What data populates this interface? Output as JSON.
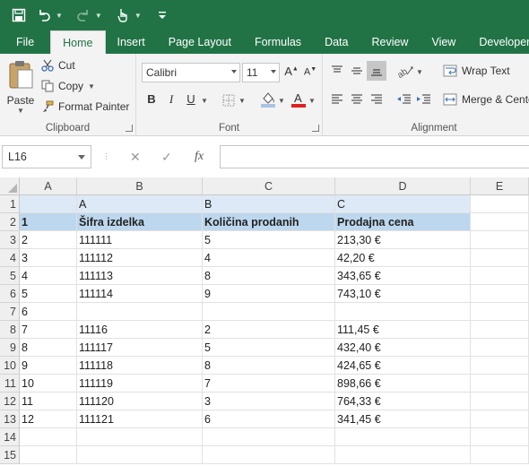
{
  "quick_access": {
    "items": [
      "save-icon",
      "undo-icon",
      "redo-icon",
      "touch-mode-icon",
      "customize-icon"
    ]
  },
  "ribbon_tabs": [
    "File",
    "Home",
    "Insert",
    "Page Layout",
    "Formulas",
    "Data",
    "Review",
    "View",
    "Developer"
  ],
  "active_tab": "Home",
  "clipboard": {
    "paste": "Paste",
    "cut": "Cut",
    "copy": "Copy",
    "format_painter": "Format Painter",
    "title": "Clipboard"
  },
  "font": {
    "name": "Calibri",
    "size": "11",
    "bold": "B",
    "italic": "I",
    "underline": "U",
    "title": "Font"
  },
  "alignment": {
    "wrap_text": "Wrap Text",
    "merge_center": "Merge & Center",
    "title": "Alignment"
  },
  "formula_bar": {
    "name_box": "L16",
    "fx": "fx",
    "value": ""
  },
  "columns": [
    "A",
    "B",
    "C",
    "D",
    "E"
  ],
  "rows": [
    {
      "n": "1",
      "cells": [
        "",
        "A",
        "B",
        "C"
      ]
    },
    {
      "n": "2",
      "cells": [
        "1",
        "Šifra izdelka",
        "Količina prodanih",
        "Prodajna cena"
      ]
    },
    {
      "n": "3",
      "cells": [
        "2",
        "111111",
        "5",
        "213,30 €"
      ]
    },
    {
      "n": "4",
      "cells": [
        "3",
        "111112",
        "4",
        "42,20 €"
      ]
    },
    {
      "n": "5",
      "cells": [
        "4",
        "111113",
        "8",
        "343,65 €"
      ]
    },
    {
      "n": "6",
      "cells": [
        "5",
        "111114",
        "9",
        "743,10 €"
      ]
    },
    {
      "n": "7",
      "cells": [
        "6",
        "",
        "",
        ""
      ]
    },
    {
      "n": "8",
      "cells": [
        "7",
        "11116",
        "2",
        "111,45 €"
      ]
    },
    {
      "n": "9",
      "cells": [
        "8",
        "111117",
        "5",
        "432,40 €"
      ]
    },
    {
      "n": "10",
      "cells": [
        "9",
        "111118",
        "8",
        "424,65 €"
      ]
    },
    {
      "n": "11",
      "cells": [
        "10",
        "111119",
        "7",
        "898,66 €"
      ]
    },
    {
      "n": "12",
      "cells": [
        "11",
        "111120",
        "3",
        "764,33 €"
      ]
    },
    {
      "n": "13",
      "cells": [
        "12",
        "111121",
        "6",
        "341,45 €"
      ]
    },
    {
      "n": "14",
      "cells": [
        "",
        "",
        "",
        ""
      ]
    },
    {
      "n": "15",
      "cells": [
        "",
        "",
        "",
        ""
      ]
    }
  ],
  "colors": {
    "brand": "#217346",
    "row1_fill": "#dde9f6",
    "row2_fill": "#bdd7ee"
  }
}
